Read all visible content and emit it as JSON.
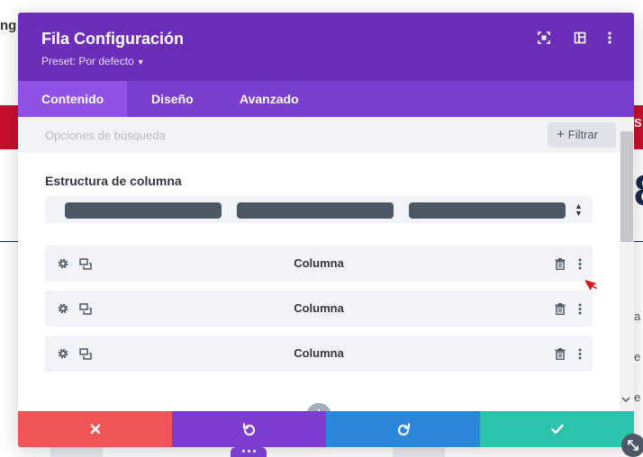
{
  "background": {
    "top_left_fragment": "ng",
    "right_red_fragment": "S",
    "right_big_fragment": "8",
    "right_side_fragments": [
      "a",
      "e",
      "e"
    ]
  },
  "modal": {
    "title": "Fila Configuración",
    "preset_label": "Preset: Por defecto",
    "header_icons": [
      "fullscreen-icon",
      "split-view-icon",
      "more-vertical-icon"
    ],
    "tabs": [
      {
        "label": "Contenido",
        "active": true
      },
      {
        "label": "Diseño",
        "active": false
      },
      {
        "label": "Avanzado",
        "active": false
      }
    ],
    "search": {
      "placeholder": "Opciones de búsqueda",
      "filter_label": "Filtrar"
    },
    "column_structure": {
      "label": "Estructura de columna",
      "selected_columns": 3
    },
    "columns": [
      {
        "label": "Columna"
      },
      {
        "label": "Columna"
      },
      {
        "label": "Columna"
      }
    ],
    "footer_buttons": [
      {
        "name": "cancel",
        "icon": "close-icon",
        "color": "#ef5555"
      },
      {
        "name": "undo",
        "icon": "undo-icon",
        "color": "#7e3bd0"
      },
      {
        "name": "redo",
        "icon": "redo-icon",
        "color": "#2b87da"
      },
      {
        "name": "save",
        "icon": "check-icon",
        "color": "#29c4a9"
      }
    ]
  },
  "colors": {
    "header": "#6c2eb9",
    "tabs": "#7b3fd0",
    "active_tab": "#8f52e5",
    "column_bar": "#4c5866",
    "row_bg": "#f1f3f6"
  }
}
